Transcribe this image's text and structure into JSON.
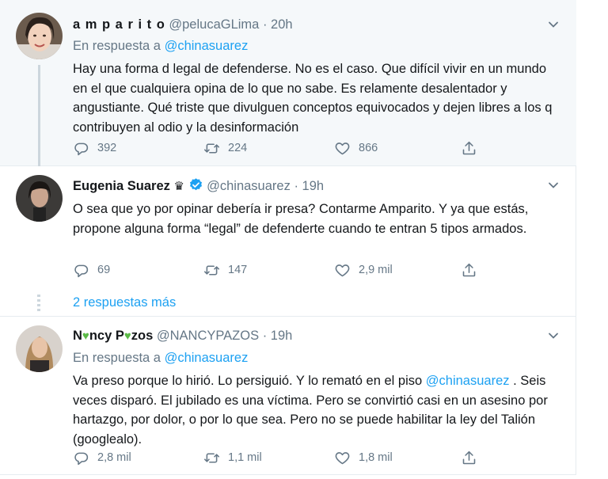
{
  "tweets": [
    {
      "name": "a m p a r i t o",
      "handle": "@pelucaGLima",
      "sep": "·",
      "time": "20h",
      "reply_prefix": "En respuesta a",
      "reply_to": "@chinasuarez",
      "text": "Hay una forma d legal de defenderse. No es el caso. Que difícil vivir en un mundo en el que cualquiera opina de lo que no sabe. Es relamente desalentador y angustiante. Qué triste que divulguen conceptos equivocados y  dejen libres a los q contribuyen al odio y la desinformación",
      "replies": "392",
      "retweets": "224",
      "likes": "866"
    },
    {
      "name": "Eugenia Suarez",
      "name_badge": "♛",
      "handle": "@chinasuarez",
      "sep": "·",
      "time": "19h",
      "text": "O sea que yo por opinar debería ir presa? Contarme Amparito. Y ya que estás, propone alguna forma “legal” de defenderte cuando te entran 5 tipos armados.",
      "replies": "69",
      "retweets": "147",
      "likes": "2,9 mil"
    },
    {
      "name_a": "N",
      "name_b": "ncy P",
      "name_c": "zos",
      "handle": "@NANCYPAZOS",
      "sep": "·",
      "time": "19h",
      "reply_prefix": "En respuesta a",
      "reply_to": "@chinasuarez",
      "text_a": "Va preso porque lo hirió. Lo persiguió. Y lo remató en el piso ",
      "text_mention": "@chinasuarez",
      "text_b": " . Seis veces disparó. El jubilado es una víctima. Pero se convirtió casi en un asesino por hartazgo, por dolor,  o por lo que sea. Pero no se puede habilitar la ley del Talión (googlealo).",
      "replies": "2,8 mil",
      "retweets": "1,1 mil",
      "likes": "1,8 mil"
    }
  ],
  "more_replies": "2 respuestas más",
  "icons": {
    "reply": "reply-icon",
    "retweet": "retweet-icon",
    "like": "heart-icon",
    "share": "share-icon",
    "menu": "chevron-down-icon",
    "verified": "verified-badge-icon",
    "green_heart": "green-heart-emoji"
  },
  "colors": {
    "link": "#1da1f2",
    "secondary_text": "#657786",
    "highlight_bg": "#f5f8fa",
    "verified": "#1da1f2",
    "green_heart": "#5bba47"
  }
}
